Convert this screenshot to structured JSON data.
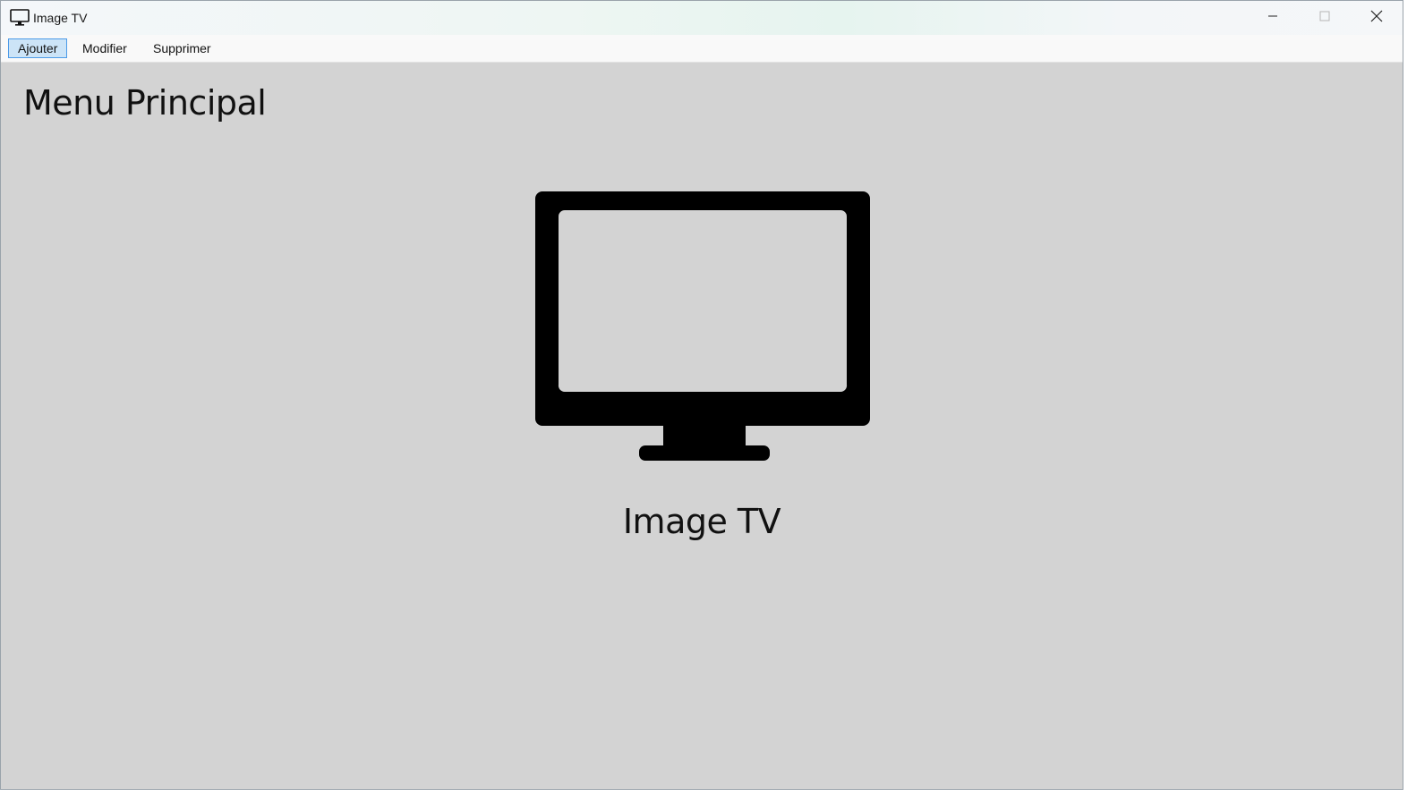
{
  "window": {
    "title": "Image TV",
    "icon": "monitor-icon"
  },
  "menubar": {
    "items": [
      {
        "label": "Ajouter",
        "selected": true
      },
      {
        "label": "Modifier",
        "selected": false
      },
      {
        "label": "Supprimer",
        "selected": false
      }
    ]
  },
  "main": {
    "heading": "Menu Principal",
    "image_icon": "tv-monitor-icon",
    "image_label": "Image TV"
  },
  "colors": {
    "content_background": "#d3d3d3",
    "menu_selection": "#cce4f7",
    "menu_selection_border": "#4c9be8"
  }
}
